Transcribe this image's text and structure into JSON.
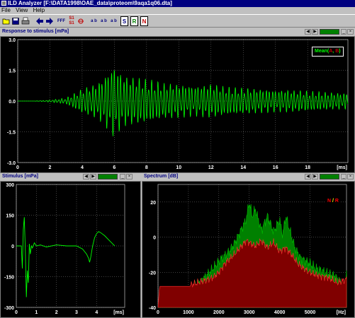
{
  "window": {
    "title": "ILD Analyzer [F:\\DATA1998\\OAE_data\\proteom\\9aqa1q06.dta]"
  },
  "menu": {
    "file": "File",
    "view": "View",
    "help": "Help"
  },
  "toolbar": {
    "fff": "FFF",
    "s1_top": "S1",
    "s1_bot": "S1",
    "ab1": "a b",
    "ab2": "a b",
    "ab3": "a b",
    "s": "S",
    "r": "R",
    "n": "N"
  },
  "colors": {
    "trace": "#00ff00",
    "spectrum_signal": "#008000",
    "spectrum_noise": "#800000",
    "noise_label": "#ff0000",
    "grid": "#808080",
    "title": "#000080"
  },
  "response": {
    "title": "Response to stimulus [mPa]",
    "legend_mean": "Mean(",
    "legend_a": "A",
    "legend_comma": ", ",
    "legend_b": "B",
    "legend_close": ")",
    "yticks": [
      "3.0",
      "1.5",
      "0.0",
      "-1.5",
      "-3.0"
    ],
    "xticks": [
      "0",
      "2",
      "4",
      "6",
      "8",
      "10",
      "12",
      "14",
      "16",
      "18"
    ],
    "xunit": "[ms]"
  },
  "stimulus": {
    "title": "Stimulus [mPa]",
    "yticks": [
      "300",
      "150",
      "0",
      "-150",
      "-300"
    ],
    "xticks": [
      "0",
      "1",
      "2",
      "3",
      "4"
    ],
    "xunit": "[ms]"
  },
  "spectrum": {
    "title": "Spectrum [dB]",
    "legend_n": "N",
    "legend_sep": " / ",
    "legend_r": "R",
    "yticks": [
      "20",
      "0",
      "-20",
      "-40"
    ],
    "xticks": [
      "0",
      "1000",
      "2000",
      "3000",
      "4000",
      "5000"
    ],
    "xunit": "[Hz]"
  },
  "chart_data": [
    {
      "type": "line",
      "title": "Response to stimulus [mPa]",
      "xlabel": "[ms]",
      "xlim": [
        0,
        20.5
      ],
      "ylim": [
        -3.0,
        3.0
      ],
      "grid": true,
      "legend": "top-right",
      "series": [
        {
          "name": "Mean(A, B)",
          "color": "#00ff00",
          "kind": "damped-oscillation",
          "envelope": [
            [
              0,
              0
            ],
            [
              1,
              0
            ],
            [
              2,
              0.05
            ],
            [
              3,
              0.15
            ],
            [
              4,
              0.6
            ],
            [
              5,
              0.9
            ],
            [
              6,
              1.8
            ],
            [
              6.5,
              1.3
            ],
            [
              7,
              1.2
            ],
            [
              8,
              1.1
            ],
            [
              9,
              0.9
            ],
            [
              10,
              0.85
            ],
            [
              11,
              0.75
            ],
            [
              12,
              0.85
            ],
            [
              13,
              0.7
            ],
            [
              14,
              0.65
            ],
            [
              15,
              0.6
            ],
            [
              16,
              0.55
            ],
            [
              17,
              0.55
            ],
            [
              18,
              0.5
            ],
            [
              19,
              0.45
            ],
            [
              20,
              0.4
            ],
            [
              20.5,
              0.4
            ]
          ]
        }
      ]
    },
    {
      "type": "line",
      "title": "Stimulus [mPa]",
      "xlabel": "[ms]",
      "xlim": [
        0,
        5.4
      ],
      "ylim": [
        -300,
        300
      ],
      "grid": true,
      "series": [
        {
          "color": "#00ff00",
          "points": [
            [
              0,
              0
            ],
            [
              0.25,
              0
            ],
            [
              0.3,
              -110
            ],
            [
              0.35,
              80
            ],
            [
              0.4,
              140
            ],
            [
              0.45,
              -30
            ],
            [
              0.5,
              -250
            ],
            [
              0.55,
              -120
            ],
            [
              0.6,
              -180
            ],
            [
              0.65,
              10
            ],
            [
              0.7,
              -40
            ],
            [
              0.75,
              0
            ],
            [
              0.8,
              -10
            ],
            [
              0.9,
              15
            ],
            [
              1.0,
              0
            ],
            [
              1.2,
              5
            ],
            [
              1.5,
              -5
            ],
            [
              2.0,
              5
            ],
            [
              2.5,
              0
            ],
            [
              3.0,
              0
            ],
            [
              3.3,
              -15
            ],
            [
              3.5,
              -40
            ],
            [
              3.6,
              -60
            ],
            [
              3.65,
              -80
            ],
            [
              3.7,
              -60
            ],
            [
              3.8,
              0
            ],
            [
              3.9,
              40
            ],
            [
              4.0,
              60
            ],
            [
              4.1,
              70
            ],
            [
              4.2,
              65
            ],
            [
              4.4,
              50
            ],
            [
              4.6,
              30
            ],
            [
              4.8,
              10
            ],
            [
              4.9,
              0
            ]
          ]
        }
      ]
    },
    {
      "type": "area",
      "title": "Spectrum [dB]",
      "xlabel": "[Hz]",
      "xlim": [
        0,
        6200
      ],
      "ylim": [
        -40,
        30
      ],
      "grid": true,
      "legend": "top-right",
      "series": [
        {
          "name": "N",
          "color": "#008000",
          "points": [
            [
              0,
              -40
            ],
            [
              1050,
              -40
            ],
            [
              1100,
              -32
            ],
            [
              1200,
              -28
            ],
            [
              1400,
              -25
            ],
            [
              1700,
              -20
            ],
            [
              1900,
              -16
            ],
            [
              2100,
              -12
            ],
            [
              2300,
              -9
            ],
            [
              2500,
              -4
            ],
            [
              2700,
              3
            ],
            [
              2900,
              10
            ],
            [
              3000,
              20
            ],
            [
              3100,
              12
            ],
            [
              3200,
              16
            ],
            [
              3400,
              4
            ],
            [
              3600,
              12
            ],
            [
              3800,
              3
            ],
            [
              4000,
              10
            ],
            [
              4100,
              1
            ],
            [
              4200,
              12
            ],
            [
              4300,
              6
            ],
            [
              4500,
              -6
            ],
            [
              4700,
              -12
            ],
            [
              5000,
              -15
            ],
            [
              5200,
              -18
            ],
            [
              5500,
              -20
            ],
            [
              5800,
              -22
            ],
            [
              6000,
              -25
            ],
            [
              6100,
              -28
            ],
            [
              6200,
              -22
            ]
          ]
        },
        {
          "name": "R",
          "color": "#800000",
          "points": [
            [
              0,
              -40
            ],
            [
              50,
              -28
            ],
            [
              350,
              -28
            ],
            [
              1050,
              -28
            ],
            [
              1100,
              -27
            ],
            [
              1300,
              -26
            ],
            [
              1500,
              -25
            ],
            [
              1800,
              -23
            ],
            [
              2000,
              -20
            ],
            [
              2200,
              -15
            ],
            [
              2500,
              -10
            ],
            [
              2700,
              -6
            ],
            [
              2900,
              -2
            ],
            [
              3000,
              -3
            ],
            [
              3200,
              -5
            ],
            [
              3400,
              -2
            ],
            [
              3600,
              -6
            ],
            [
              3800,
              -3
            ],
            [
              4000,
              -8
            ],
            [
              4200,
              -6
            ],
            [
              4400,
              -10
            ],
            [
              4600,
              -15
            ],
            [
              4800,
              -18
            ],
            [
              5000,
              -20
            ],
            [
              5300,
              -22
            ],
            [
              5600,
              -23
            ],
            [
              5900,
              -26
            ],
            [
              6200,
              -24
            ]
          ]
        }
      ]
    }
  ]
}
